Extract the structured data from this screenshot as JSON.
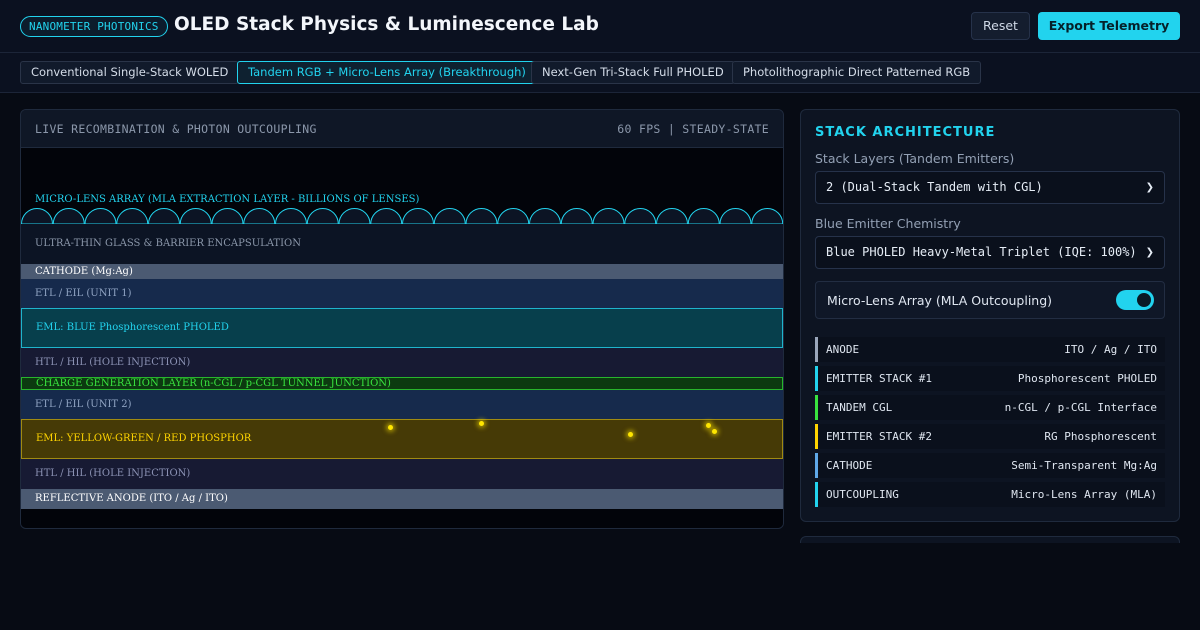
{
  "header": {
    "badge": "NANOMETER PHOTONICS",
    "title": "OLED Stack Physics & Luminescence Lab",
    "reset_label": "Reset",
    "export_label": "Export Telemetry"
  },
  "presets": [
    {
      "label": "Conventional Single-Stack WOLED",
      "active": false
    },
    {
      "label": "Tandem RGB + Micro-Lens Array (Breakthrough)",
      "active": true
    },
    {
      "label": "Next-Gen Tri-Stack Full PHOLED",
      "active": false
    },
    {
      "label": "Photolithographic Direct Patterned RGB",
      "active": false
    }
  ],
  "simulation": {
    "title": "LIVE RECOMBINATION & PHOTON OUTCOUPLING",
    "status": "60 FPS | STEADY-STATE",
    "mla_label": "MICRO-LENS ARRAY (MLA EXTRACTION LAYER - BILLIONS OF LENSES)",
    "layers": [
      {
        "label": "ULTRA-THIN GLASS & BARRIER ENCAPSULATION",
        "bg": "#0c1424",
        "color": "#8b97aa",
        "border": ""
      },
      {
        "label": "CATHODE (Mg:Ag)",
        "bg": "#4b5a72",
        "color": "#ffffff",
        "border": ""
      },
      {
        "label": "ETL / EIL (UNIT 1)",
        "bg": "#162a4c",
        "color": "#8fa3c2",
        "border": ""
      },
      {
        "label": "EML: BLUE Phosphorescent PHOLED",
        "bg": "#073f4c",
        "color": "#22d3ee",
        "border": "#1fb4cc"
      },
      {
        "label": "HTL / HIL (HOLE INJECTION)",
        "bg": "#171a33",
        "color": "#8b92b4",
        "border": ""
      },
      {
        "label": "CHARGE GENERATION LAYER (n-CGL / p-CGL TUNNEL JUNCTION)",
        "bg": "#0c3a10",
        "color": "#39e33f",
        "border": "#28b52c"
      },
      {
        "label": "ETL / EIL (UNIT 2)",
        "bg": "#162a4c",
        "color": "#8fa3c2",
        "border": ""
      },
      {
        "label": "EML: YELLOW-GREEN / RED PHOSPHOR",
        "bg": "#463a06",
        "color": "#ffd400",
        "border": "#a08a12"
      },
      {
        "label": "HTL / HIL (HOLE INJECTION)",
        "bg": "#171a33",
        "color": "#8b92b4",
        "border": ""
      },
      {
        "label": "REFLECTIVE ANODE (ITO / Ag / ITO)",
        "bg": "#4b5a72",
        "color": "#ffffff",
        "border": ""
      }
    ]
  },
  "sidebar": {
    "title": "STACK ARCHITECTURE",
    "stack_layers_label": "Stack Layers (Tandem Emitters)",
    "stack_layers_value": "2 (Dual-Stack Tandem with CGL)",
    "blue_chem_label": "Blue Emitter Chemistry",
    "blue_chem_value": "Blue PHOLED Heavy-Metal Triplet (IQE: 100%)",
    "mla_toggle_label": "Micro-Lens Array (MLA Outcoupling)",
    "mla_enabled": true,
    "stack_summary": [
      {
        "key": "ANODE",
        "value": "ITO / Ag / ITO",
        "color": "#9aa6bb"
      },
      {
        "key": "EMITTER STACK #1",
        "value": "Phosphorescent PHOLED",
        "color": "#22d3ee"
      },
      {
        "key": "TANDEM CGL",
        "value": "n-CGL / p-CGL Interface",
        "color": "#39e33f"
      },
      {
        "key": "EMITTER STACK #2",
        "value": "RG Phosphorescent",
        "color": "#ffd400"
      },
      {
        "key": "CATHODE",
        "value": "Semi-Transparent Mg:Ag",
        "color": "#5fa8e8"
      },
      {
        "key": "OUTCOUPLING",
        "value": "Micro-Lens Array (MLA)",
        "color": "#22d3ee"
      }
    ]
  },
  "colors": {
    "accent": "#22d3ee",
    "background": "#070b14",
    "panel": "#0d1422"
  }
}
